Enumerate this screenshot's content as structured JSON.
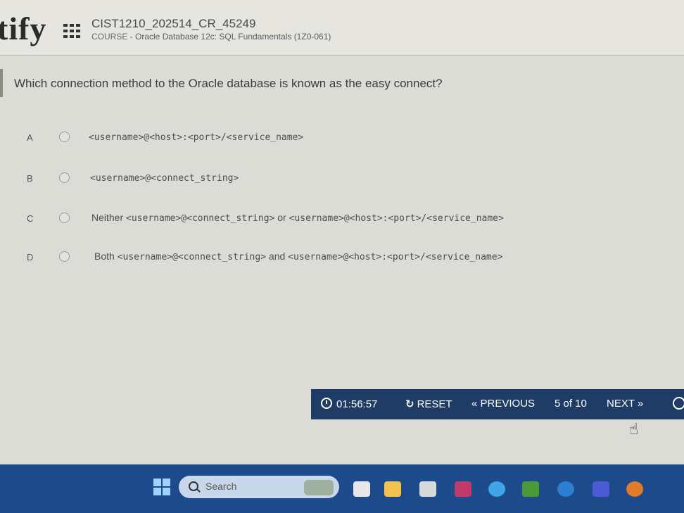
{
  "header": {
    "logo_text": "tify",
    "exam_code": "CIST1210_202514_CR_45249",
    "course_label": "COURSE",
    "course_separator": " - ",
    "course_name": "Oracle Database 12c: SQL Fundamentals (1Z0-061)"
  },
  "question": {
    "text": "Which connection method to the Oracle database is known as the easy connect?"
  },
  "options": [
    {
      "letter": "A",
      "prefix": "",
      "code1": "<username>@<host>:<port>/<service_name>",
      "joiner": "",
      "code2": ""
    },
    {
      "letter": "B",
      "prefix": "",
      "code1": "<username>@<connect_string>",
      "joiner": "",
      "code2": ""
    },
    {
      "letter": "C",
      "prefix": "Neither ",
      "code1": "<username>@<connect_string>",
      "joiner": " or ",
      "code2": "<username>@<host>:<port>/<service_name>"
    },
    {
      "letter": "D",
      "prefix": "Both ",
      "code1": "<username>@<connect_string>",
      "joiner": " and ",
      "code2": "<username>@<host>:<port>/<service_name>"
    }
  ],
  "toolbar": {
    "timer": "01:56:57",
    "reset_label": "RESET",
    "previous_label": "PREVIOUS",
    "progress": "5 of 10",
    "next_label": "NEXT"
  },
  "taskbar": {
    "search_placeholder": "Search"
  },
  "colors": {
    "toolbar_bg": "#1f3c66",
    "taskbar_bg": "#1c4a8a",
    "page_bg": "#dcdcd6"
  }
}
